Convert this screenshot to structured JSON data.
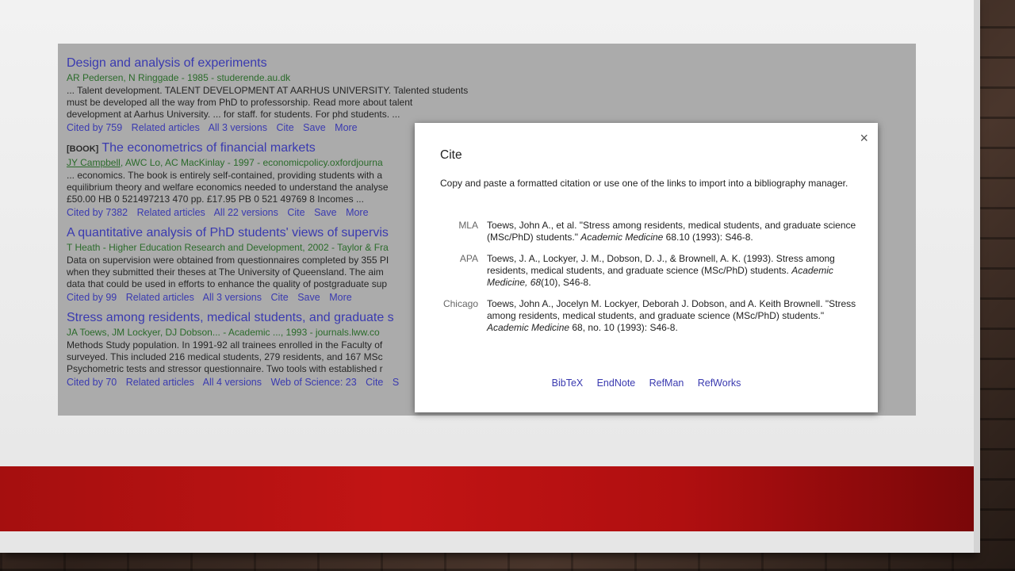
{
  "results": [
    {
      "tag": "",
      "title": "Design and analysis of experiments",
      "authors": "AR Pedersen, N Ringgade - 1985 - studerende.au.dk",
      "snippet": [
        "... Talent development. TALENT DEVELOPMENT AT AARHUS UNIVERSITY. Talented students",
        "must be developed all the way from PhD to professorship. Read more about talent",
        "development at Aarhus University. ... for staff. for students. For phd students. ..."
      ],
      "links": [
        "Cited by 759",
        "Related articles",
        "All 3 versions",
        "Cite",
        "Save",
        "More"
      ]
    },
    {
      "tag": "[BOOK]",
      "title": "The econometrics of financial markets",
      "authors_u": "JY Campbell",
      "authors": ", AWC Lo, AC MacKinlay - 1997 - economicpolicy.oxfordjourna",
      "snippet": [
        "... economics. The book is entirely self-contained, providing students with a",
        "equilibrium theory and welfare economics needed to understand the analyse",
        "£50.00 HB 0 521497213 470 pp. £17.95 PB 0 521 49769 8 Incomes ..."
      ],
      "links": [
        "Cited by 7382",
        "Related articles",
        "All 22 versions",
        "Cite",
        "Save",
        "More"
      ]
    },
    {
      "tag": "",
      "title": "A quantitative analysis of PhD students' views of supervis",
      "authors": "T Heath - Higher Education Research and Development, 2002 - Taylor & Fra",
      "snippet": [
        "Data on supervision were obtained from questionnaires completed by 355 PI",
        "when they submitted their theses at The University of Queensland. The aim",
        "data that could be used in efforts to enhance the quality of postgraduate sup"
      ],
      "links": [
        "Cited by 99",
        "Related articles",
        "All 3 versions",
        "Cite",
        "Save",
        "More"
      ]
    },
    {
      "tag": "",
      "title": "Stress among residents, medical students, and graduate s",
      "authors": "JA Toews, JM Lockyer, DJ Dobson... - Academic ..., 1993 - journals.lww.co",
      "snippet": [
        "Methods Study population. In 1991-92 all trainees enrolled in the Faculty of",
        "surveyed. This included 216 medical students, 279 residents, and 167 MSc",
        "Psychometric tests and stressor questionnaire. Two tools with established r"
      ],
      "links": [
        "Cited by 70",
        "Related articles",
        "All 4 versions",
        "Web of Science: 23",
        "Cite",
        "S"
      ]
    }
  ],
  "modal": {
    "close": "×",
    "title": "Cite",
    "description": "Copy and paste a formatted citation or use one of the links to import into a bibliography manager.",
    "citations": [
      {
        "style": "MLA",
        "pre": "Toews, John A., et al. \"Stress among residents, medical students, and graduate science (MSc/PhD) students.\" ",
        "journal": "Academic Medicine",
        "post": " 68.10 (1993): S46-8."
      },
      {
        "style": "APA",
        "pre": "Toews, J. A., Lockyer, J. M., Dobson, D. J., & Brownell, A. K. (1993). Stress among residents, medical students, and graduate science (MSc/PhD) students. ",
        "journal": "Academic Medicine, 68",
        "post": "(10), S46-8."
      },
      {
        "style": "Chicago",
        "pre": "Toews, John A., Jocelyn M. Lockyer, Deborah J. Dobson, and A. Keith Brownell. \"Stress among residents, medical students, and graduate science (MSc/PhD) students.\" ",
        "journal": "Academic Medicine",
        "post": " 68, no. 10 (1993): S46-8."
      }
    ],
    "imports": [
      "BibTeX",
      "EndNote",
      "RefMan",
      "RefWorks"
    ]
  },
  "colors": {
    "link": "#3a3ab0",
    "author_green": "#2b6b2b",
    "band_red": "#c21414"
  }
}
